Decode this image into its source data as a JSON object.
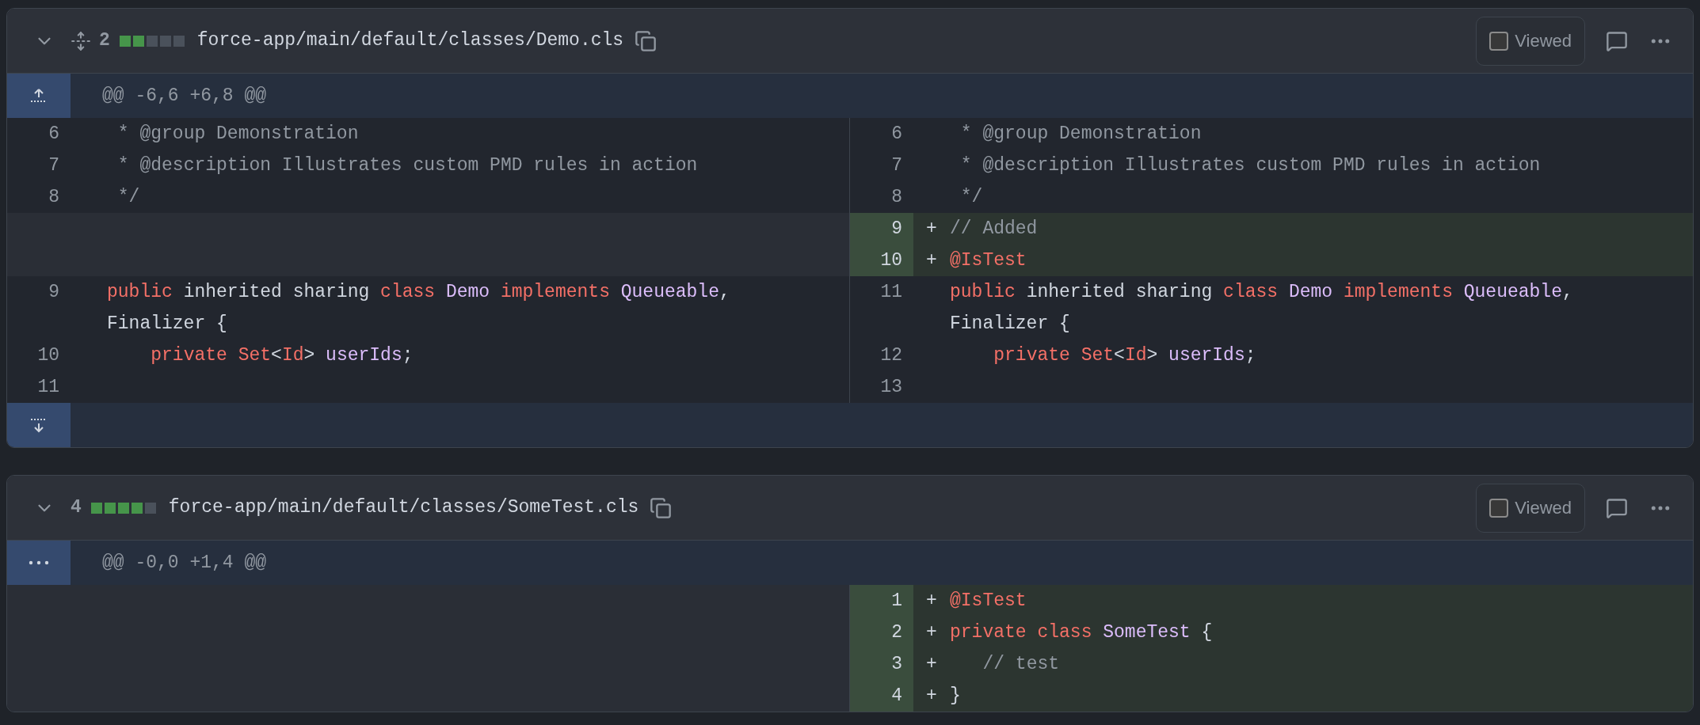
{
  "files": [
    {
      "additions": "2",
      "stat": [
        {
          "added": true
        },
        {
          "added": true
        },
        {
          "added": false
        },
        {
          "added": false
        },
        {
          "added": false
        }
      ],
      "path": "force-app/main/default/classes/Demo.cls",
      "show_expand_all": true,
      "viewed": {
        "label": "Viewed",
        "checked": false
      },
      "hunk": {
        "kind": "expand_up",
        "header": "@@ -6,6 +6,8 @@"
      },
      "rows": [
        {
          "left": {
            "number": "6",
            "tokens": [
              {
                "kind": "comment",
                "text": " * @group Demonstration"
              }
            ]
          },
          "right": {
            "number": "6",
            "added": false,
            "tokens": [
              {
                "kind": "comment",
                "text": " * @group Demonstration"
              }
            ]
          }
        },
        {
          "left": {
            "number": "7",
            "tokens": [
              {
                "kind": "comment",
                "text": " * @description Illustrates custom PMD rules in action"
              }
            ]
          },
          "right": {
            "number": "7",
            "added": false,
            "tokens": [
              {
                "kind": "comment",
                "text": " * @description Illustrates custom PMD rules in action"
              }
            ]
          }
        },
        {
          "left": {
            "number": "8",
            "tokens": [
              {
                "kind": "comment",
                "text": " */"
              }
            ]
          },
          "right": {
            "number": "8",
            "added": false,
            "tokens": [
              {
                "kind": "comment",
                "text": " */"
              }
            ]
          }
        },
        {
          "left": null,
          "right": {
            "number": "9",
            "added": true,
            "sign": "+",
            "tokens": [
              {
                "kind": "comment",
                "text": "// Added"
              }
            ]
          }
        },
        {
          "left": null,
          "right": {
            "number": "10",
            "added": true,
            "sign": "+",
            "tokens": [
              {
                "kind": "keyword",
                "text": "@IsTest"
              }
            ]
          }
        },
        {
          "left": {
            "number": "9",
            "tokens": [
              {
                "kind": "keyword",
                "text": "public"
              },
              {
                "kind": "text",
                "text": " inherited sharing "
              },
              {
                "kind": "keyword",
                "text": "class"
              },
              {
                "kind": "entity",
                "text": " Demo"
              },
              {
                "kind": "keyword",
                "text": " implements"
              },
              {
                "kind": "entity",
                "text": " Queueable"
              },
              {
                "kind": "text",
                "text": ", Finalizer {"
              }
            ]
          },
          "right": {
            "number": "11",
            "added": false,
            "tokens": [
              {
                "kind": "keyword",
                "text": "public"
              },
              {
                "kind": "text",
                "text": " inherited sharing "
              },
              {
                "kind": "keyword",
                "text": "class"
              },
              {
                "kind": "entity",
                "text": " Demo"
              },
              {
                "kind": "keyword",
                "text": " implements"
              },
              {
                "kind": "entity",
                "text": " Queueable"
              },
              {
                "kind": "text",
                "text": ", Finalizer {"
              }
            ]
          }
        },
        {
          "left": {
            "number": "10",
            "tokens": [
              {
                "kind": "keyword",
                "text": "    private"
              },
              {
                "kind": "keyword",
                "text": " Set"
              },
              {
                "kind": "text",
                "text": "<"
              },
              {
                "kind": "keyword",
                "text": "Id"
              },
              {
                "kind": "text",
                "text": ">"
              },
              {
                "kind": "entity",
                "text": " userIds"
              },
              {
                "kind": "text",
                "text": ";"
              }
            ]
          },
          "right": {
            "number": "12",
            "added": false,
            "tokens": [
              {
                "kind": "keyword",
                "text": "    private"
              },
              {
                "kind": "keyword",
                "text": " Set"
              },
              {
                "kind": "text",
                "text": "<"
              },
              {
                "kind": "keyword",
                "text": "Id"
              },
              {
                "kind": "text",
                "text": ">"
              },
              {
                "kind": "entity",
                "text": " userIds"
              },
              {
                "kind": "text",
                "text": ";"
              }
            ]
          }
        },
        {
          "left": {
            "number": "11"
          },
          "right": {
            "number": "13",
            "added": false
          }
        }
      ],
      "footer": {
        "kind": "expand_down"
      }
    },
    {
      "additions": "4",
      "stat": [
        {
          "added": true
        },
        {
          "added": true
        },
        {
          "added": true
        },
        {
          "added": true
        },
        {
          "added": false
        }
      ],
      "path": "force-app/main/default/classes/SomeTest.cls",
      "viewed": {
        "label": "Viewed",
        "checked": false
      },
      "hunk": {
        "kind": "expand_all",
        "header": "@@ -0,0 +1,4 @@"
      },
      "rows": [
        {
          "left": null,
          "right": {
            "number": "1",
            "added": true,
            "sign": "+",
            "tokens": [
              {
                "kind": "keyword",
                "text": "@IsTest"
              }
            ]
          }
        },
        {
          "left": null,
          "right": {
            "number": "2",
            "added": true,
            "sign": "+",
            "tokens": [
              {
                "kind": "keyword",
                "text": "private"
              },
              {
                "kind": "keyword",
                "text": " class"
              },
              {
                "kind": "entity",
                "text": " SomeTest"
              },
              {
                "kind": "text",
                "text": " {"
              }
            ]
          }
        },
        {
          "left": null,
          "right": {
            "number": "3",
            "added": true,
            "sign": "+",
            "tokens": [
              {
                "kind": "comment",
                "text": "   // test"
              }
            ]
          }
        },
        {
          "left": null,
          "right": {
            "number": "4",
            "added": true,
            "sign": "+",
            "tokens": [
              {
                "kind": "text",
                "text": "}"
              }
            ]
          }
        }
      ]
    }
  ]
}
